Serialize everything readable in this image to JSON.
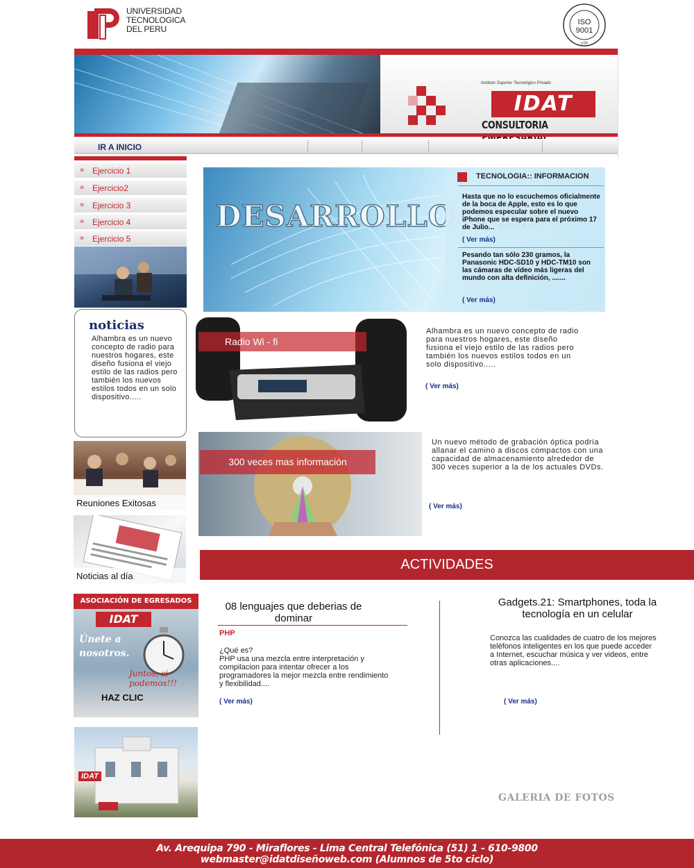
{
  "header": {
    "university_line1": "UNIVERSIDAD",
    "university_line2": "TECNOLOGICA",
    "university_line3": "DEL PERU",
    "iso_label": "ISO",
    "iso_number": "9001",
    "iso_ring": "CERTIFIED QUALITY SYSTEM",
    "iso_bottom": "UTP"
  },
  "banner": {
    "institute_small": "Instituto Superior Tecnológico Privado",
    "logo": "IDAT",
    "subtitle": "CONSULTORIA EMPRESARIAL"
  },
  "nav": {
    "home_label": "IR A INICIO"
  },
  "sidebar": {
    "items": [
      {
        "label": "Ejercicio 1"
      },
      {
        "label": "Ejercicio2"
      },
      {
        "label": "Ejercicio 3"
      },
      {
        "label": "Ejercicio 4"
      },
      {
        "label": "Ejercicio 5"
      }
    ],
    "noticias_title": "noticias",
    "noticias_text": "Alhambra es un nuevo concepto de radio para nuestros hogares, este diseño fusiona el viejo estilo de las radios pero también los nuevos estilos todos en un solo dispositivo.....",
    "reuniones_caption": "Reuniones Exitosas",
    "noticias_dia_caption": "Noticias al día",
    "egresados_bar": "ASOCIACIÓN DE EGRESADOS",
    "egresados_logo": "IDAT",
    "egresados_line1": "Únete a",
    "egresados_line2": "nosotros.",
    "egresados_slogan": "Juntos, si podemos!!!",
    "egresados_cta": "HAZ CLIC",
    "building_sign": "IDAT"
  },
  "hero": {
    "title": "DESARROLLO WEB",
    "panel_heading": "TECNOLOGIA:: INFORMACION",
    "item1": "Hasta que no lo escuchemos oficialmente de la boca de Apple, esto es lo que podemos especular sobre el nuevo iPhone que se espera para el próximo 17 de Julio...",
    "item2": "Pesando tan sólo 230 gramos, la Panasonic HDC-SD10 y HDC-TM10 son las cámaras de vídeo más ligeras del mundo con alta definición, .......",
    "more": "( Ver más)"
  },
  "radio": {
    "label": "Radio Wi  - fi",
    "text": "Alhambra es un nuevo concepto de radio para nuestros hogares, este diseño fusiona el viejo estilo de las radios pero también los nuevos estilos todos en un solo dispositivo.....",
    "more": "( Ver más)"
  },
  "cd": {
    "label": "300 veces mas información",
    "text": "Un nuevo método de grabación óptica podría allanar el camino a discos compactos con una capacidad de almacenamiento alrededor de 300 veces superior a la de los actuales DVDs.",
    "more": "( Ver más)"
  },
  "actividades": {
    "heading": "ACTIVIDADES",
    "col1_title": "08 lenguajes que deberias de dominar",
    "col1_sub": "PHP",
    "col1_text1": "¿Qué es?",
    "col1_text2": "PHP usa una mezcla entre interpretación y compilacion para intentar ofrecer a los programadores la mejor mezcla entre rendimiento y flexibilidad....",
    "col1_more": "( Ver más)",
    "col2_title": "Gadgets.21: Smartphones, toda la tecnología en un celular",
    "col2_text": "Conozca las cualidades de cuatro de los mejores teléfonos inteligentes en los que puede acceder a Internet, escuchar música y ver videos, entre otras aplicaciones....",
    "col2_more": "( Ver más)"
  },
  "galeria": "GALERIA DE FOTOS",
  "footer": {
    "line1": "Av. Arequipa 790 - Miraflores - Lima Central Telefónica (51) 1 - 610-9800",
    "line2": "webmaster@idatdiseñoweb.com (Alumnos de 5to ciclo)"
  }
}
